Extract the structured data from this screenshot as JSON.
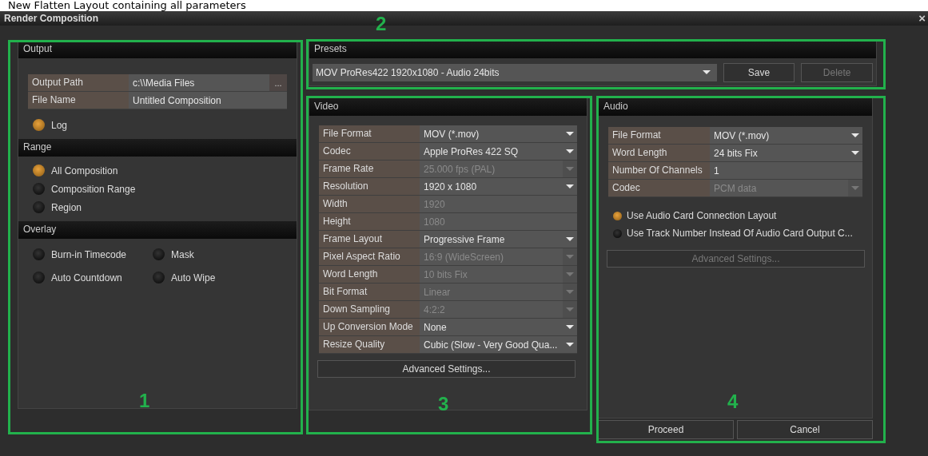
{
  "caption": "New Flatten Layout containing all parameters",
  "window": {
    "title": "Render Composition",
    "close": "×"
  },
  "output": {
    "title": "Output",
    "fields": [
      {
        "label": "Output Path",
        "value": "c:\\\\Media Files",
        "browse": "..."
      },
      {
        "label": "File Name",
        "value": "Untitled Composition"
      }
    ],
    "log": {
      "label": "Log",
      "checked": true
    }
  },
  "range": {
    "title": "Range",
    "options": [
      {
        "label": "All Composition",
        "selected": true
      },
      {
        "label": "Composition Range",
        "selected": false
      },
      {
        "label": "Region",
        "selected": false
      }
    ]
  },
  "overlay": {
    "title": "Overlay",
    "options": [
      {
        "label": "Burn-in Timecode",
        "checked": false
      },
      {
        "label": "Mask",
        "checked": false
      },
      {
        "label": "Auto Countdown",
        "checked": false
      },
      {
        "label": "Auto Wipe",
        "checked": false
      }
    ]
  },
  "presets": {
    "title": "Presets",
    "value": "MOV ProRes422 1920x1080 - Audio 24bits",
    "buttons": [
      {
        "label": "Save",
        "disabled": false
      },
      {
        "label": "Delete",
        "disabled": true
      }
    ]
  },
  "video": {
    "title": "Video",
    "rows": [
      {
        "label": "File Format",
        "value": "MOV (*.mov)",
        "kind": "dropdown",
        "disabled": false
      },
      {
        "label": "Codec",
        "value": "Apple ProRes 422 SQ",
        "kind": "dropdown",
        "disabled": false
      },
      {
        "label": "Frame Rate",
        "value": "25.000 fps (PAL)",
        "kind": "dropdown",
        "disabled": true
      },
      {
        "label": "Resolution",
        "value": "1920 x 1080",
        "kind": "dropdown",
        "disabled": false
      },
      {
        "label": "Width",
        "value": "1920",
        "kind": "text",
        "disabled": true
      },
      {
        "label": "Height",
        "value": "1080",
        "kind": "text",
        "disabled": true
      },
      {
        "label": "Frame Layout",
        "value": "Progressive Frame",
        "kind": "dropdown",
        "disabled": false
      },
      {
        "label": "Pixel Aspect Ratio",
        "value": "16:9 (WideScreen)",
        "kind": "dropdown",
        "disabled": true
      },
      {
        "label": "Word Length",
        "value": "10 bits Fix",
        "kind": "dropdown",
        "disabled": true
      },
      {
        "label": "Bit Format",
        "value": "Linear",
        "kind": "dropdown",
        "disabled": true
      },
      {
        "label": "Down Sampling",
        "value": "4:2:2",
        "kind": "dropdown",
        "disabled": true
      },
      {
        "label": "Up Conversion Mode",
        "value": "None",
        "kind": "dropdown",
        "disabled": false
      },
      {
        "label": "Resize Quality",
        "value": "Cubic (Slow - Very Good Qua...",
        "kind": "dropdown",
        "disabled": false
      }
    ],
    "advanced": {
      "label": "Advanced Settings...",
      "disabled": false
    }
  },
  "audio": {
    "title": "Audio",
    "rows": [
      {
        "label": "File Format",
        "value": "MOV (*.mov)",
        "kind": "dropdown",
        "disabled": false
      },
      {
        "label": "Word Length",
        "value": "24 bits Fix",
        "kind": "dropdown",
        "disabled": false
      },
      {
        "label": "Number Of Channels",
        "value": "1",
        "kind": "text",
        "disabled": false
      },
      {
        "label": "Codec",
        "value": "PCM data",
        "kind": "dropdown",
        "disabled": true
      }
    ],
    "options": [
      {
        "label": "Use Audio Card Connection Layout",
        "checked": true
      },
      {
        "label": "Use Track Number Instead Of Audio Card Output C...",
        "checked": false
      }
    ],
    "advanced": {
      "label": "Advanced Settings...",
      "disabled": true
    }
  },
  "actions": [
    {
      "label": "Proceed"
    },
    {
      "label": "Cancel"
    }
  ],
  "annotations": [
    {
      "label": "1"
    },
    {
      "label": "2"
    },
    {
      "label": "3"
    },
    {
      "label": "4"
    }
  ]
}
